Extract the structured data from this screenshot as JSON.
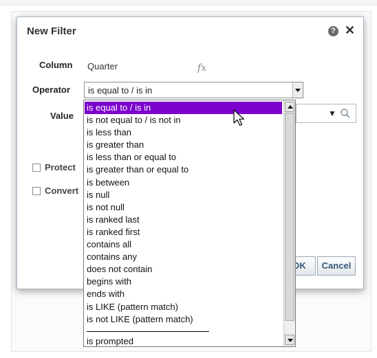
{
  "dialog": {
    "title": "New Filter",
    "help_icon": "help-icon",
    "help_glyph": "?",
    "close_icon": "close-icon",
    "close_glyph": "✕"
  },
  "form": {
    "column_label": "Column",
    "column_value": "Quarter",
    "fx_glyph": "fx",
    "operator_label": "Operator",
    "operator_selected": "is equal to / is in",
    "value_label": "Value",
    "value_arrow": "▼",
    "protect_label": "Protect",
    "convert_label": "Convert"
  },
  "buttons": {
    "ok": "OK",
    "cancel": "Cancel"
  },
  "operator_options": [
    "is equal to / is in",
    "is not equal to / is not in",
    "is less than",
    "is greater than",
    "is less than or equal to",
    "is greater than or equal to",
    "is between",
    "is null",
    "is not null",
    "is ranked last",
    "is ranked first",
    "contains all",
    "contains any",
    "does not contain",
    "begins with",
    "ends with",
    "is LIKE (pattern match)",
    "is not LIKE (pattern match)"
  ],
  "operator_prompted": "is prompted",
  "colors": {
    "selected_highlight": "#7b00cc",
    "button_text": "#36587a"
  }
}
